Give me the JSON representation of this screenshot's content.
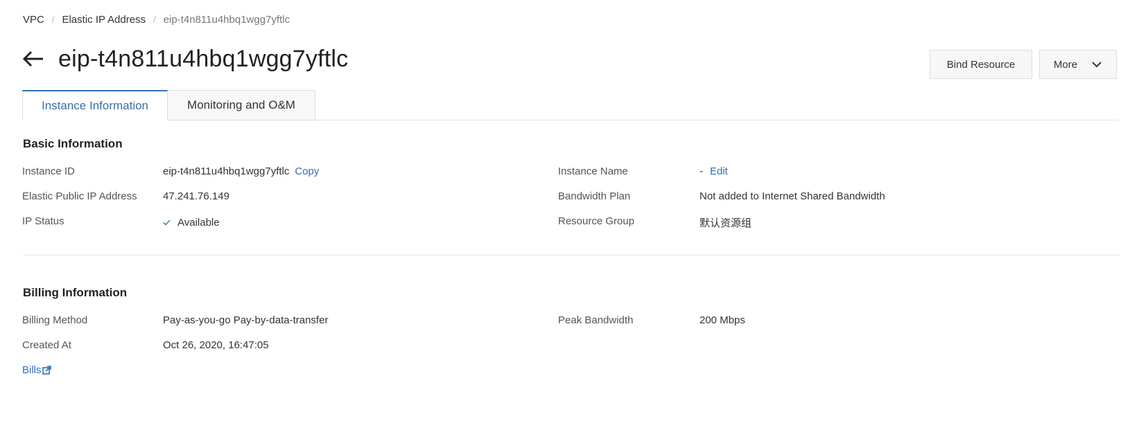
{
  "breadcrumb": {
    "items": [
      "VPC",
      "Elastic IP Address",
      "eip-t4n811u4hbq1wgg7yftlc"
    ],
    "separator": "/"
  },
  "header": {
    "title": "eip-t4n811u4hbq1wgg7yftlc",
    "back_icon": "arrow-left-icon",
    "bind_resource_label": "Bind Resource",
    "more_label": "More",
    "more_icon": "chevron-down-icon"
  },
  "tabs": [
    {
      "label": "Instance Information",
      "active": true
    },
    {
      "label": "Monitoring and O&M",
      "active": false
    }
  ],
  "basic_info": {
    "title": "Basic Information",
    "instance_id_label": "Instance ID",
    "instance_id_value": "eip-t4n811u4hbq1wgg7yftlc",
    "copy_label": "Copy",
    "public_ip_label": "Elastic Public IP Address",
    "public_ip_value": "47.241.76.149",
    "ip_status_label": "IP Status",
    "ip_status_value": "Available",
    "ip_status_icon": "check-icon",
    "instance_name_label": "Instance Name",
    "instance_name_value": "-",
    "edit_label": "Edit",
    "bandwidth_plan_label": "Bandwidth Plan",
    "bandwidth_plan_value": "Not added to Internet Shared Bandwidth",
    "resource_group_label": "Resource Group",
    "resource_group_value": "默认资源组"
  },
  "billing_info": {
    "title": "Billing Information",
    "billing_method_label": "Billing Method",
    "billing_method_value": "Pay-as-you-go Pay-by-data-transfer",
    "created_at_label": "Created At",
    "created_at_value": "Oct 26, 2020, 16:47:05",
    "peak_bandwidth_label": "Peak Bandwidth",
    "peak_bandwidth_value": "200 Mbps",
    "bills_label": "Bills",
    "bills_icon": "external-link-icon"
  },
  "colors": {
    "accent": "#2f6fb6",
    "success": "#3a9a4e",
    "text": "#333333",
    "label": "#555555"
  }
}
